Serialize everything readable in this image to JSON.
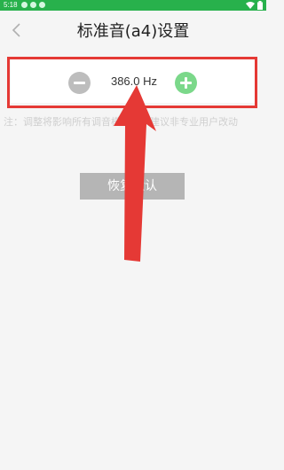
{
  "status_bar": {
    "time": "5:18",
    "icons": [
      "notification-icon",
      "notification-icon",
      "notification-icon",
      "wifi-icon",
      "battery-icon"
    ]
  },
  "header": {
    "back_icon": "chevron-left-icon",
    "title": "标准音(a4)设置"
  },
  "stepper": {
    "value": "386.0 Hz",
    "decrease_icon": "minus-icon",
    "increase_icon": "plus-icon"
  },
  "note": {
    "text": "注：调整将影响所有调音模式，不建议非专业用户改动"
  },
  "actions": {
    "reset_label": "恢复默认"
  },
  "colors": {
    "status_bar": "#28b14c",
    "highlight": "#e53935",
    "plus_button": "#7bd88a",
    "minus_button": "#bdbdbd",
    "reset_button": "#b5b5b5"
  }
}
